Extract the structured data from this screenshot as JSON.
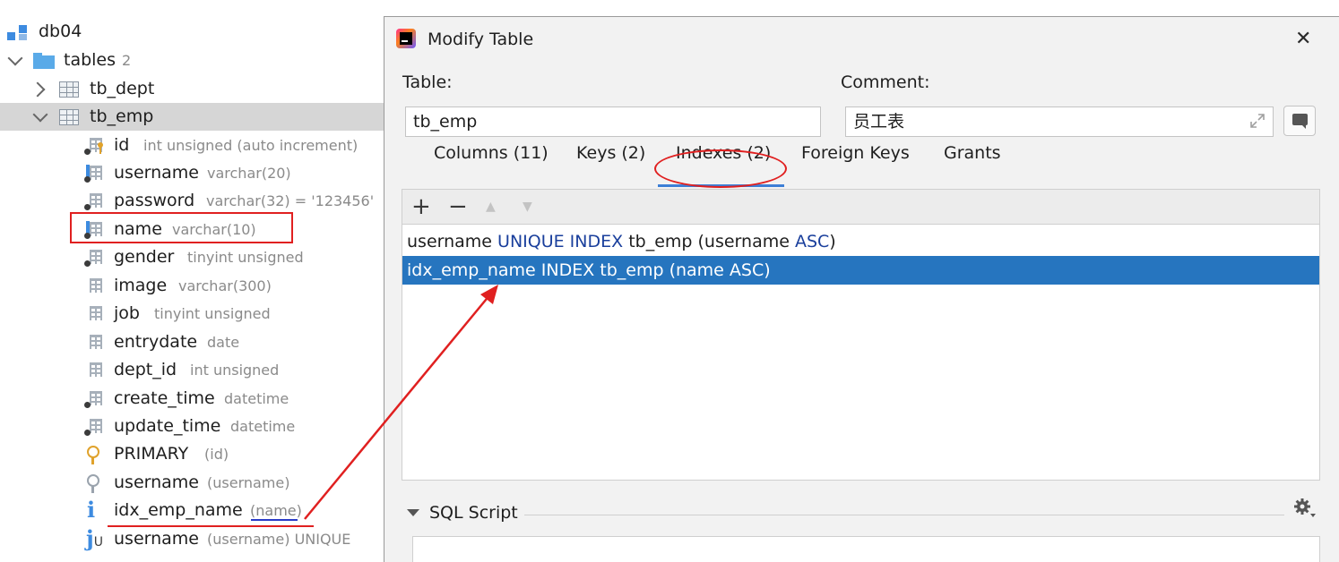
{
  "tree": {
    "db": "db04",
    "tables_folder": "tables",
    "tables_count": "2",
    "tables": [
      "tb_dept",
      "tb_emp"
    ],
    "columns": [
      {
        "name": "id",
        "type": "int unsigned (auto increment)"
      },
      {
        "name": "username",
        "type": "varchar(20)"
      },
      {
        "name": "password",
        "type": "varchar(32) = '123456'"
      },
      {
        "name": "name",
        "type": "varchar(10)"
      },
      {
        "name": "gender",
        "type": "tinyint unsigned"
      },
      {
        "name": "image",
        "type": "varchar(300)"
      },
      {
        "name": "job",
        "type": "tinyint unsigned"
      },
      {
        "name": "entrydate",
        "type": "date"
      },
      {
        "name": "dept_id",
        "type": "int unsigned"
      },
      {
        "name": "create_time",
        "type": "datetime"
      },
      {
        "name": "update_time",
        "type": "datetime"
      }
    ],
    "keys": [
      {
        "name": "PRIMARY",
        "type": "(id)"
      },
      {
        "name": "username",
        "type": "(username)"
      }
    ],
    "indexes": [
      {
        "name": "idx_emp_name",
        "type": "(name)"
      },
      {
        "name": "username",
        "type": "(username) UNIQUE"
      }
    ]
  },
  "dialog": {
    "title": "Modify Table",
    "close_glyph": "✕",
    "table_label": "Table:",
    "table_value": "tb_emp",
    "comment_label": "Comment:",
    "comment_value": "员工表",
    "tabs": [
      "Columns (11)",
      "Keys (2)",
      "Indexes (2)",
      "Foreign Keys",
      "Grants"
    ],
    "active_tab": "Indexes (2)",
    "toolbar": {
      "add": "+",
      "remove": "−",
      "up": "▲",
      "down": "▼"
    },
    "index_rows": [
      {
        "p1": "username",
        "k1": "UNIQUE INDEX",
        "p2": "tb_emp (username",
        "k2": "ASC",
        "p3": ")"
      },
      {
        "text": "idx_emp_name INDEX tb_emp (name ASC)"
      }
    ],
    "sql_script_label": "SQL Script"
  },
  "colors": {
    "selection": "#2675bf",
    "annotation_red": "#e02020",
    "annotation_blue": "#2a3bc7",
    "keyword_blue": "#1a3f9c"
  }
}
